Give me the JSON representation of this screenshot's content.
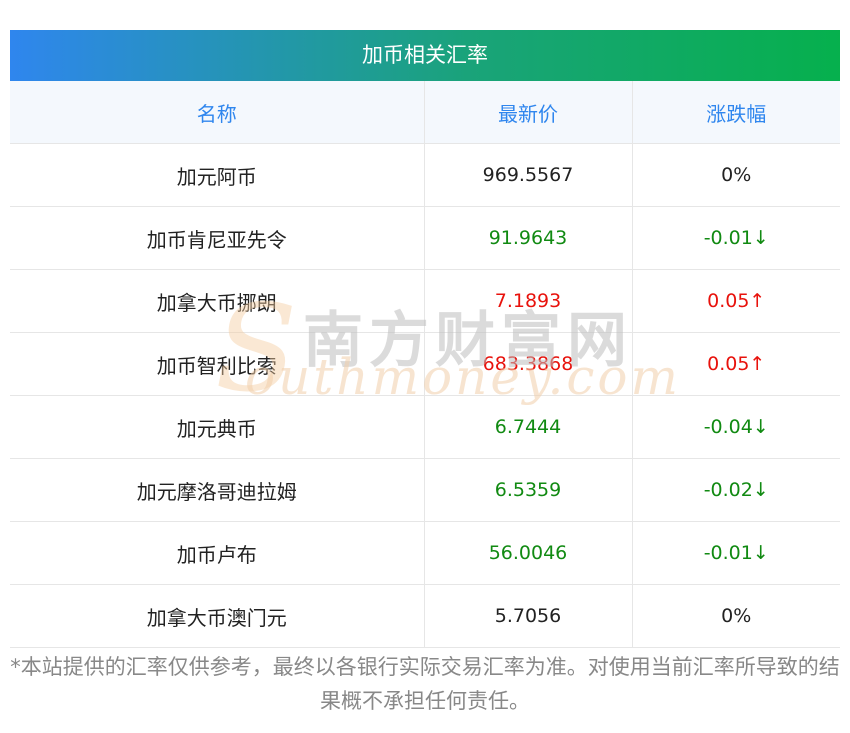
{
  "table": {
    "title": "加币相关汇率",
    "headers": {
      "name": "名称",
      "price": "最新价",
      "change": "涨跌幅"
    },
    "rows": [
      {
        "name": "加元阿币",
        "price": "969.5567",
        "change": "0%",
        "trend": "flat"
      },
      {
        "name": "加币肯尼亚先令",
        "price": "91.9643",
        "change": "-0.01↓",
        "trend": "down"
      },
      {
        "name": "加拿大币挪朗",
        "price": "7.1893",
        "change": "0.05↑",
        "trend": "up"
      },
      {
        "name": "加币智利比索",
        "price": "683.3868",
        "change": "0.05↑",
        "trend": "up"
      },
      {
        "name": "加元典币",
        "price": "6.7444",
        "change": "-0.04↓",
        "trend": "down"
      },
      {
        "name": "加元摩洛哥迪拉姆",
        "price": "6.5359",
        "change": "-0.02↓",
        "trend": "down"
      },
      {
        "name": "加币卢布",
        "price": "56.0046",
        "change": "-0.01↓",
        "trend": "down"
      },
      {
        "name": "加拿大币澳门元",
        "price": "5.7056",
        "change": "0%",
        "trend": "flat"
      }
    ]
  },
  "watermark": {
    "chinese": "南方财富网",
    "english": "outhmoney.com",
    "initial": "S"
  },
  "disclaimer": "*本站提供的汇率仅供参考，最终以各银行实际交易汇率为准。对使用当前汇率所导致的结果概不承担任何责任。",
  "colors": {
    "header_text": "#2f86ee",
    "up": "#e8120c",
    "down": "#118a12",
    "title_gradient_start": "#2f86ee",
    "title_gradient_end": "#06b04d"
  }
}
